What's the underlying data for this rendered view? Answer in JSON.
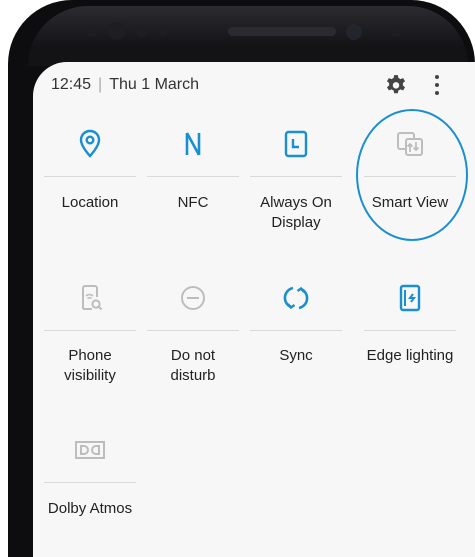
{
  "status": {
    "time": "12:45",
    "separator": "|",
    "date": "Thu 1 March"
  },
  "header_icons": [
    "gear-icon",
    "more-vertical-icon"
  ],
  "colors": {
    "accent": "#1a8fd0",
    "inactive": "#b9b9b9",
    "screen_bg": "#f7f7f7"
  },
  "tiles": [
    {
      "label": "Location",
      "icon": "location-pin-icon",
      "active": true
    },
    {
      "label": "NFC",
      "icon": "nfc-icon",
      "active": true
    },
    {
      "label_line1": "Always On",
      "label_line2": "Display",
      "icon": "always-on-display-icon",
      "active": true
    },
    {
      "label": "Smart View",
      "icon": "smart-view-icon",
      "active": false
    },
    {
      "label_line1": "Phone",
      "label_line2": "visibility",
      "icon": "phone-visibility-icon",
      "active": false
    },
    {
      "label_line1": "Do not",
      "label_line2": "disturb",
      "icon": "do-not-disturb-icon",
      "active": false
    },
    {
      "label": "Sync",
      "icon": "sync-icon",
      "active": true
    },
    {
      "label": "Edge lighting",
      "icon": "edge-lighting-icon",
      "active": true
    },
    {
      "label": "Dolby Atmos",
      "icon": "dolby-atmos-icon",
      "active": false
    }
  ]
}
